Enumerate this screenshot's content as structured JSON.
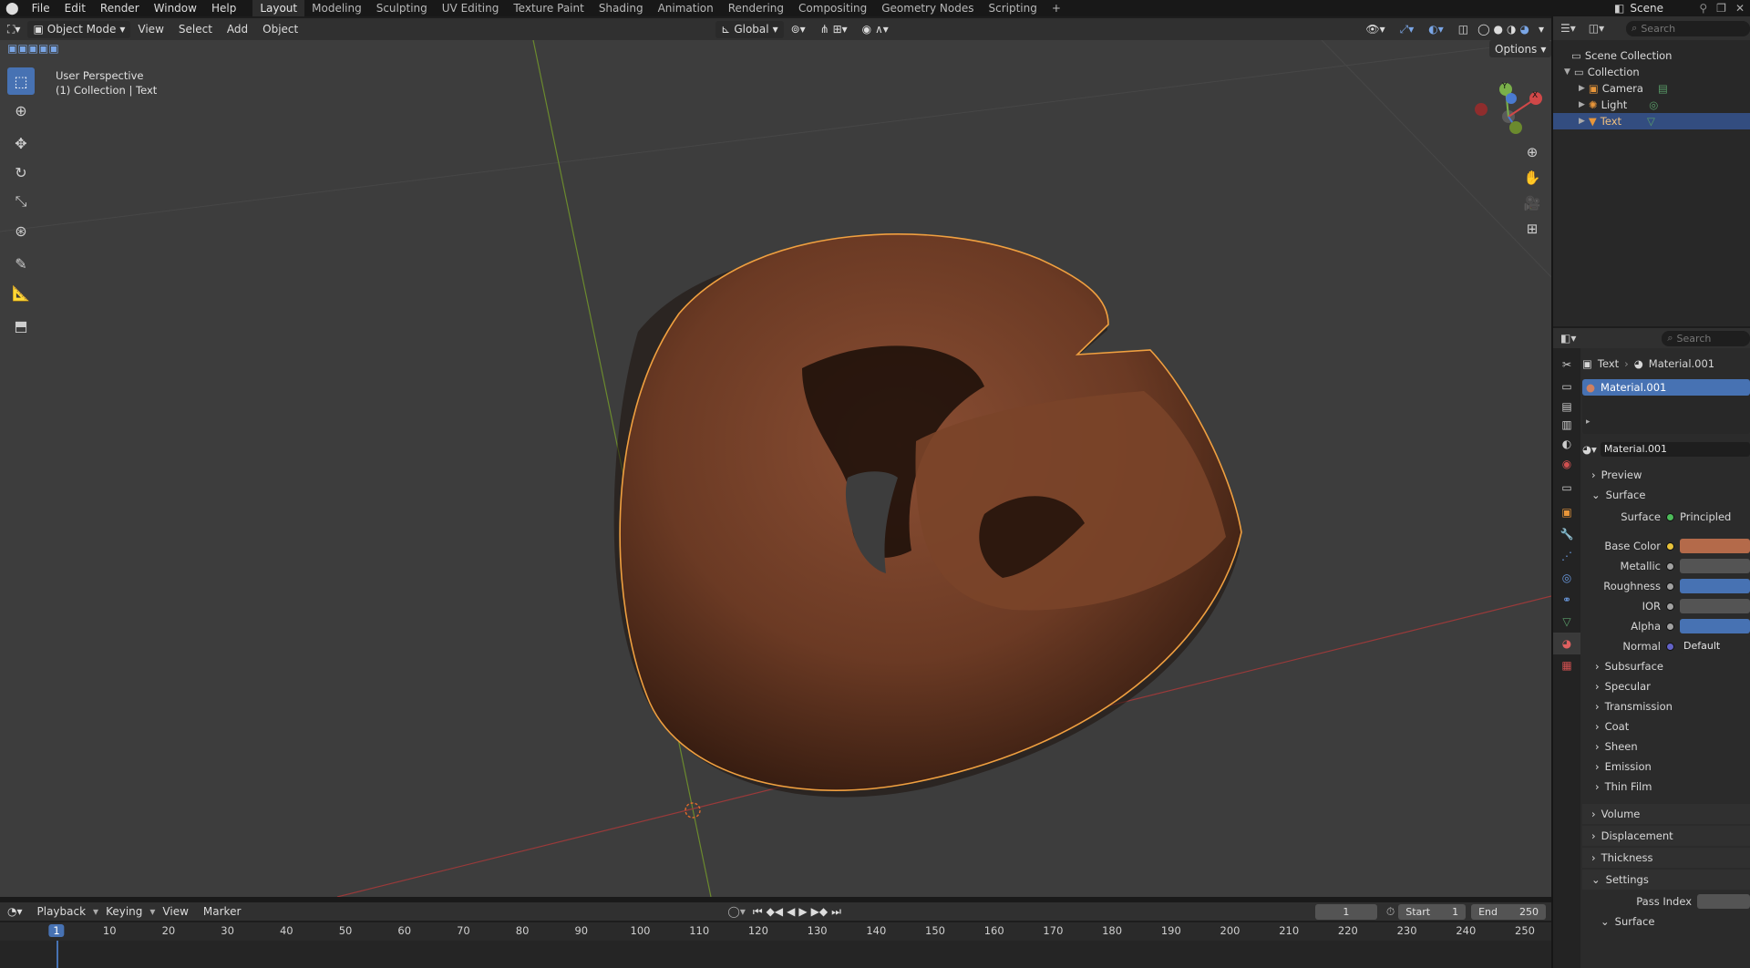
{
  "topbar": {
    "menus": [
      "File",
      "Edit",
      "Render",
      "Window",
      "Help"
    ],
    "workspaces": [
      "Layout",
      "Modeling",
      "Sculpting",
      "UV Editing",
      "Texture Paint",
      "Shading",
      "Animation",
      "Rendering",
      "Compositing",
      "Geometry Nodes",
      "Scripting"
    ],
    "active_workspace": "Layout",
    "add_tab": "+",
    "scene_label": "Scene"
  },
  "viewport_header": {
    "mode": "Object Mode",
    "menus": [
      "View",
      "Select",
      "Add",
      "Object"
    ],
    "orientation": "Global",
    "options": "Options"
  },
  "viewport": {
    "perspective": "User Perspective",
    "collection_info": "(1) Collection | Text",
    "gizmo": {
      "y": "Y",
      "x": "X"
    },
    "object_color": "#6b3a24",
    "outline_color": "#f0a040"
  },
  "outliner": {
    "search_placeholder": "Search",
    "items": [
      {
        "label": "Scene Collection"
      },
      {
        "label": "Collection"
      },
      {
        "label": "Camera"
      },
      {
        "label": "Light"
      },
      {
        "label": "Text"
      }
    ]
  },
  "properties": {
    "search_placeholder": "Search",
    "breadcrumb": {
      "object": "Text",
      "material": "Material.001"
    },
    "slot": "Material.001",
    "material_name": "Material.001",
    "panels": {
      "preview": "Preview",
      "surface": "Surface"
    },
    "surface_shader": {
      "label": "Surface",
      "value": "Principled"
    },
    "inputs": [
      {
        "label": "Base Color",
        "value": "",
        "color": "#b46a4a",
        "dot": "#e8c23a"
      },
      {
        "label": "Metallic",
        "value": "",
        "color": "#545454",
        "dot": "#a0a0a0"
      },
      {
        "label": "Roughness",
        "value": "",
        "color": "#4772b3",
        "dot": "#a0a0a0"
      },
      {
        "label": "IOR",
        "value": "",
        "color": "#545454",
        "dot": "#a0a0a0"
      },
      {
        "label": "Alpha",
        "value": "",
        "color": "#4772b3",
        "dot": "#a0a0a0"
      },
      {
        "label": "Normal",
        "value": "Default",
        "color": "#2b2b2b",
        "dot": "#6363c7"
      }
    ],
    "subpanels": [
      "Subsurface",
      "Specular",
      "Transmission",
      "Coat",
      "Sheen",
      "Emission",
      "Thin Film"
    ],
    "lower_panels": [
      "Volume",
      "Displacement",
      "Thickness",
      "Settings"
    ],
    "pass_index_label": "Pass Index",
    "bottom_panel": "Surface"
  },
  "timeline": {
    "menus": [
      "Playback",
      "Keying",
      "View",
      "Marker"
    ],
    "current_frame": "1",
    "start_label": "Start",
    "start_value": "1",
    "end_label": "End",
    "end_value": "250",
    "ruler": [
      "1",
      "10",
      "20",
      "30",
      "40",
      "50",
      "60",
      "70",
      "80",
      "90",
      "100",
      "110",
      "120",
      "130",
      "140",
      "150",
      "160",
      "170",
      "180",
      "190",
      "200",
      "210",
      "220",
      "230",
      "240",
      "250"
    ]
  }
}
